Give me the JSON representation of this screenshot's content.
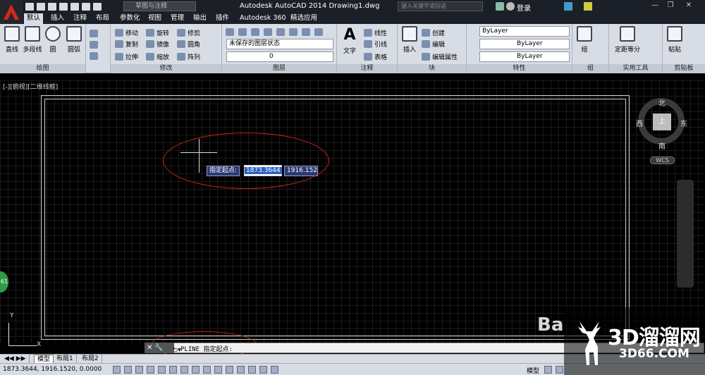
{
  "title_bar": {
    "workspace": "草图与注释",
    "app_title": "Autodesk AutoCAD 2014    Drawing1.dwg",
    "search_placeholder": "键入关键字或短语",
    "login": "登录"
  },
  "tabs": [
    "默认",
    "插入",
    "注释",
    "布局",
    "参数化",
    "视图",
    "管理",
    "输出",
    "插件",
    "Autodesk 360",
    "精选应用"
  ],
  "ribbon": {
    "draw": {
      "label": "绘图",
      "line": "直线",
      "polyline": "多段线",
      "circle": "圆",
      "arc": "圆弧"
    },
    "modify": {
      "label": "修改",
      "move": "移动",
      "rotate": "旋转",
      "trim": "修剪",
      "copy": "复制",
      "mirror": "镜像",
      "fillet": "圆角",
      "stretch": "拉伸",
      "scale": "缩放",
      "array": "阵列"
    },
    "layers": {
      "label": "图层",
      "state": "未保存的图层状态",
      "current": "0"
    },
    "annotation": {
      "label": "注释",
      "text": "文字",
      "linear": "线性",
      "leader": "引线",
      "table": "表格"
    },
    "block": {
      "label": "块",
      "insert": "插入",
      "create": "创建",
      "edit": "编辑",
      "edit_attr": "编辑属性"
    },
    "properties": {
      "label": "特性",
      "color": "ByLayer",
      "linetype": "ByLayer",
      "lineweight": "ByLayer"
    },
    "groups": {
      "label": "组",
      "group": "组"
    },
    "utilities": {
      "label": "实用工具",
      "measure": "定距等分"
    },
    "clipboard": {
      "label": "剪贴板",
      "paste": "粘贴"
    }
  },
  "viewport": {
    "label": "[-][俯视][二维线框]",
    "prompt": "指定起点:",
    "x_value": "1873.3644",
    "y_value": "1916.152",
    "compass": {
      "north": "北",
      "south": "南",
      "east": "东",
      "west": "西",
      "top": "上"
    },
    "wcs": "WCS",
    "badge": "61"
  },
  "ucs": {
    "x": "X",
    "y": "Y"
  },
  "command_line": {
    "text": "PLINE 指定起点:"
  },
  "layout_tabs": [
    "模型",
    "布局1",
    "布局2"
  ],
  "status": {
    "coords": "1873.3644,  1916.1520,  0.0000",
    "model": "模型"
  },
  "watermark": {
    "brand": "3D溜溜网",
    "url": "3D66.COM",
    "bai": "Ba"
  },
  "colors": {
    "accent": "#c8261c",
    "ribbon": "#d8dde5",
    "titlebar": "#1b1f27"
  }
}
